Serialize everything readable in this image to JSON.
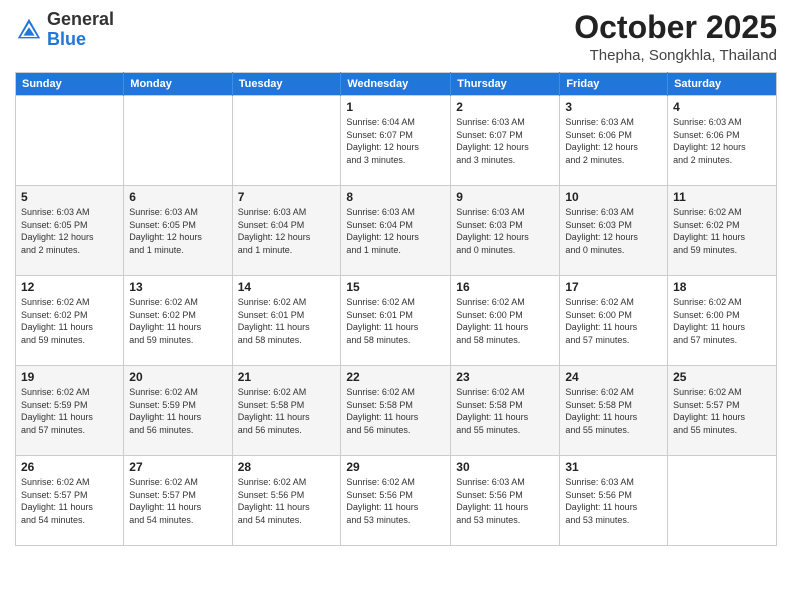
{
  "header": {
    "logo": {
      "general": "General",
      "blue": "Blue"
    },
    "month": "October 2025",
    "location": "Thepha, Songkhla, Thailand"
  },
  "weekdays": [
    "Sunday",
    "Monday",
    "Tuesday",
    "Wednesday",
    "Thursday",
    "Friday",
    "Saturday"
  ],
  "weeks": [
    [
      {
        "day": "",
        "info": ""
      },
      {
        "day": "",
        "info": ""
      },
      {
        "day": "",
        "info": ""
      },
      {
        "day": "1",
        "info": "Sunrise: 6:04 AM\nSunset: 6:07 PM\nDaylight: 12 hours\nand 3 minutes."
      },
      {
        "day": "2",
        "info": "Sunrise: 6:03 AM\nSunset: 6:07 PM\nDaylight: 12 hours\nand 3 minutes."
      },
      {
        "day": "3",
        "info": "Sunrise: 6:03 AM\nSunset: 6:06 PM\nDaylight: 12 hours\nand 2 minutes."
      },
      {
        "day": "4",
        "info": "Sunrise: 6:03 AM\nSunset: 6:06 PM\nDaylight: 12 hours\nand 2 minutes."
      }
    ],
    [
      {
        "day": "5",
        "info": "Sunrise: 6:03 AM\nSunset: 6:05 PM\nDaylight: 12 hours\nand 2 minutes."
      },
      {
        "day": "6",
        "info": "Sunrise: 6:03 AM\nSunset: 6:05 PM\nDaylight: 12 hours\nand 1 minute."
      },
      {
        "day": "7",
        "info": "Sunrise: 6:03 AM\nSunset: 6:04 PM\nDaylight: 12 hours\nand 1 minute."
      },
      {
        "day": "8",
        "info": "Sunrise: 6:03 AM\nSunset: 6:04 PM\nDaylight: 12 hours\nand 1 minute."
      },
      {
        "day": "9",
        "info": "Sunrise: 6:03 AM\nSunset: 6:03 PM\nDaylight: 12 hours\nand 0 minutes."
      },
      {
        "day": "10",
        "info": "Sunrise: 6:03 AM\nSunset: 6:03 PM\nDaylight: 12 hours\nand 0 minutes."
      },
      {
        "day": "11",
        "info": "Sunrise: 6:02 AM\nSunset: 6:02 PM\nDaylight: 11 hours\nand 59 minutes."
      }
    ],
    [
      {
        "day": "12",
        "info": "Sunrise: 6:02 AM\nSunset: 6:02 PM\nDaylight: 11 hours\nand 59 minutes."
      },
      {
        "day": "13",
        "info": "Sunrise: 6:02 AM\nSunset: 6:02 PM\nDaylight: 11 hours\nand 59 minutes."
      },
      {
        "day": "14",
        "info": "Sunrise: 6:02 AM\nSunset: 6:01 PM\nDaylight: 11 hours\nand 58 minutes."
      },
      {
        "day": "15",
        "info": "Sunrise: 6:02 AM\nSunset: 6:01 PM\nDaylight: 11 hours\nand 58 minutes."
      },
      {
        "day": "16",
        "info": "Sunrise: 6:02 AM\nSunset: 6:00 PM\nDaylight: 11 hours\nand 58 minutes."
      },
      {
        "day": "17",
        "info": "Sunrise: 6:02 AM\nSunset: 6:00 PM\nDaylight: 11 hours\nand 57 minutes."
      },
      {
        "day": "18",
        "info": "Sunrise: 6:02 AM\nSunset: 6:00 PM\nDaylight: 11 hours\nand 57 minutes."
      }
    ],
    [
      {
        "day": "19",
        "info": "Sunrise: 6:02 AM\nSunset: 5:59 PM\nDaylight: 11 hours\nand 57 minutes."
      },
      {
        "day": "20",
        "info": "Sunrise: 6:02 AM\nSunset: 5:59 PM\nDaylight: 11 hours\nand 56 minutes."
      },
      {
        "day": "21",
        "info": "Sunrise: 6:02 AM\nSunset: 5:58 PM\nDaylight: 11 hours\nand 56 minutes."
      },
      {
        "day": "22",
        "info": "Sunrise: 6:02 AM\nSunset: 5:58 PM\nDaylight: 11 hours\nand 56 minutes."
      },
      {
        "day": "23",
        "info": "Sunrise: 6:02 AM\nSunset: 5:58 PM\nDaylight: 11 hours\nand 55 minutes."
      },
      {
        "day": "24",
        "info": "Sunrise: 6:02 AM\nSunset: 5:58 PM\nDaylight: 11 hours\nand 55 minutes."
      },
      {
        "day": "25",
        "info": "Sunrise: 6:02 AM\nSunset: 5:57 PM\nDaylight: 11 hours\nand 55 minutes."
      }
    ],
    [
      {
        "day": "26",
        "info": "Sunrise: 6:02 AM\nSunset: 5:57 PM\nDaylight: 11 hours\nand 54 minutes."
      },
      {
        "day": "27",
        "info": "Sunrise: 6:02 AM\nSunset: 5:57 PM\nDaylight: 11 hours\nand 54 minutes."
      },
      {
        "day": "28",
        "info": "Sunrise: 6:02 AM\nSunset: 5:56 PM\nDaylight: 11 hours\nand 54 minutes."
      },
      {
        "day": "29",
        "info": "Sunrise: 6:02 AM\nSunset: 5:56 PM\nDaylight: 11 hours\nand 53 minutes."
      },
      {
        "day": "30",
        "info": "Sunrise: 6:03 AM\nSunset: 5:56 PM\nDaylight: 11 hours\nand 53 minutes."
      },
      {
        "day": "31",
        "info": "Sunrise: 6:03 AM\nSunset: 5:56 PM\nDaylight: 11 hours\nand 53 minutes."
      },
      {
        "day": "",
        "info": ""
      }
    ]
  ]
}
